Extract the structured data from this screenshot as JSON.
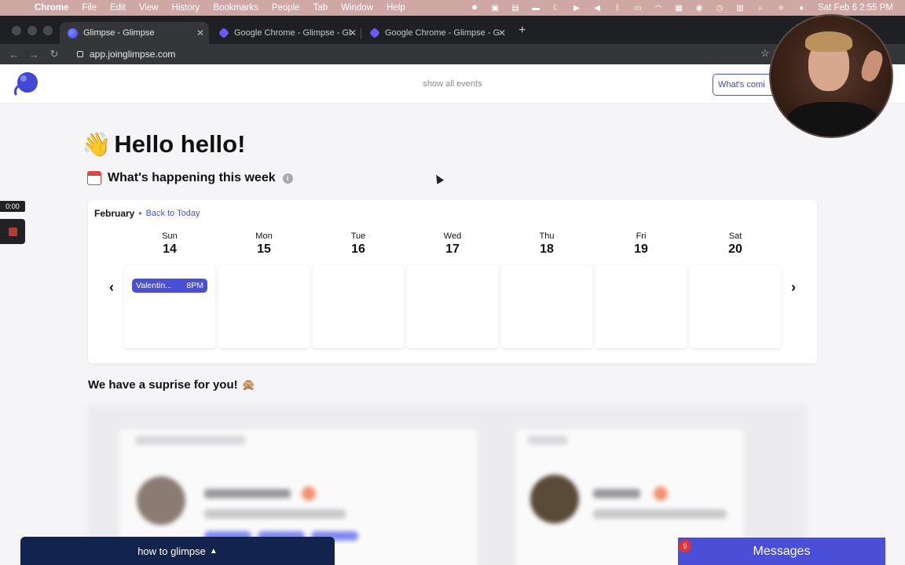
{
  "menubar": {
    "app_name": "Chrome",
    "items": [
      "File",
      "Edit",
      "View",
      "History",
      "Bookmarks",
      "People",
      "Tab",
      "Window",
      "Help"
    ],
    "clock": "Sat Feb 6  2:55 PM"
  },
  "browser": {
    "tabs": [
      {
        "title": "Glimpse - Glimpse",
        "icon": "glimpse-icon",
        "active": true
      },
      {
        "title": "Google Chrome - Glimpse - Gl",
        "icon": "chrome-icon",
        "active": false
      },
      {
        "title": "Google Chrome - Glimpse - Gl",
        "icon": "chrome-icon",
        "active": false
      }
    ],
    "url": "app.joinglimpse.com"
  },
  "header": {
    "show_all": "show all events",
    "whats_coming": "What's comi"
  },
  "main": {
    "greeting": "Hello hello!",
    "greeting_emoji": "👋",
    "week_heading": "What's happening this week",
    "info_glyph": "i"
  },
  "calendar": {
    "month": "February",
    "separator": "•",
    "back_to_today": "Back to Today",
    "days": [
      {
        "name": "Sun",
        "num": "14"
      },
      {
        "name": "Mon",
        "num": "15"
      },
      {
        "name": "Tue",
        "num": "16"
      },
      {
        "name": "Wed",
        "num": "17"
      },
      {
        "name": "Thu",
        "num": "18"
      },
      {
        "name": "Fri",
        "num": "19"
      },
      {
        "name": "Sat",
        "num": "20"
      }
    ],
    "event": {
      "title": "Valentin...",
      "time": "8PM"
    }
  },
  "surprise": {
    "title": "We have a suprise for you!",
    "emoji": "🙊"
  },
  "recorder": {
    "time": "0:00"
  },
  "bottom": {
    "how_to": "how to glimpse",
    "messages": "Messages",
    "messages_badge": "9"
  },
  "colors": {
    "accent": "#4b4fd8",
    "navy": "#12234e",
    "badge": "#e5322f"
  }
}
